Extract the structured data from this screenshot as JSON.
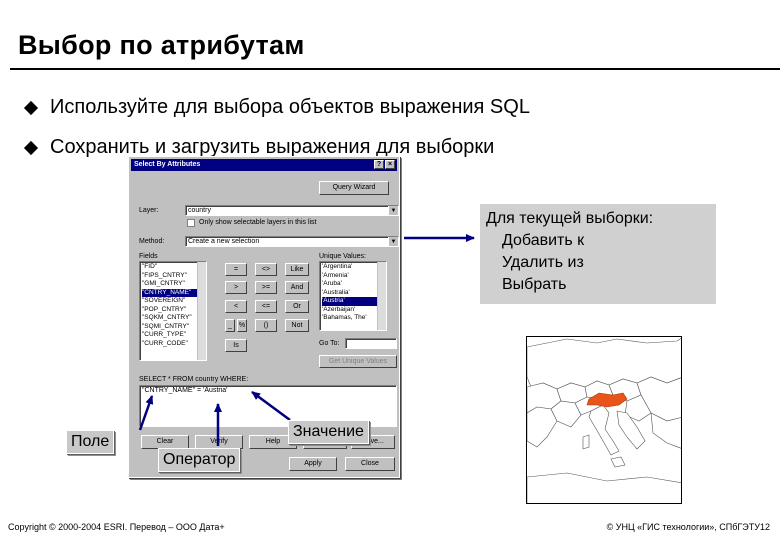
{
  "slide": {
    "title": "Выбор по атрибутам",
    "bullets": [
      "Используйте для выбора объектов выражения SQL",
      "Сохранить и загрузить выражения для выборки"
    ],
    "footer_left": "Copyright © 2000-2004 ESRI. Перевод – ООО Дата+",
    "footer_right": "© УНЦ «ГИС технологии», СПбГЭТУ12"
  },
  "dialog": {
    "title": "Select By Attributes",
    "query_wizard_label": "Query Wizard",
    "layer_label": "Layer:",
    "layer_value": "country",
    "only_selectable_label": "Only show selectable layers in this list",
    "method_label": "Method:",
    "method_value": "Create a new selection",
    "fields_label": "Fields",
    "fields": [
      "\"FID\"",
      "\"FIPS_CNTRY\"",
      "\"GMI_CNTRY\"",
      "\"CNTRY_NAME\"",
      "\"SOVEREIGN\"",
      "\"POP_CNTRY\"",
      "\"SQKM_CNTRY\"",
      "\"SQMI_CNTRY\"",
      "\"CURR_TYPE\"",
      "\"CURR_CODE\""
    ],
    "unique_values_label": "Unique Values:",
    "unique_values": [
      "'Argentina'",
      "'Armenia'",
      "'Aruba'",
      "'Australia'",
      "'Austria'",
      "'Azerbaijan'",
      "'Bahamas, The'"
    ],
    "operators": [
      [
        "=",
        "<>",
        "Like"
      ],
      [
        ">",
        ">=",
        "And"
      ],
      [
        "<",
        "<=",
        "Or"
      ],
      [
        "_",
        "%",
        "()",
        "Not"
      ]
    ],
    "is_label": "Is",
    "goto_label": "Go To:",
    "get_unique_label": "Get Unique Values",
    "sql_label": "SELECT * FROM country WHERE:",
    "sql_expression": "\"CNTRY_NAME\" = 'Austria'",
    "clear_label": "Clear",
    "verify_label": "Verify",
    "help_label": "Help",
    "load_label": "Load...",
    "save_label": "Save...",
    "apply_label": "Apply",
    "close_label": "Close",
    "ctrl_help": "?",
    "ctrl_close": "×"
  },
  "callout": {
    "head": "Для текущей выборки:",
    "items": [
      "Добавить к",
      "Удалить из",
      "Выбрать"
    ]
  },
  "labels": {
    "field": "Поле",
    "operator": "Оператор",
    "value": "Значение"
  },
  "colors": {
    "arrow": "#000080",
    "selected_country": "#e8541a",
    "callout_bg": "#d0d0d0"
  }
}
